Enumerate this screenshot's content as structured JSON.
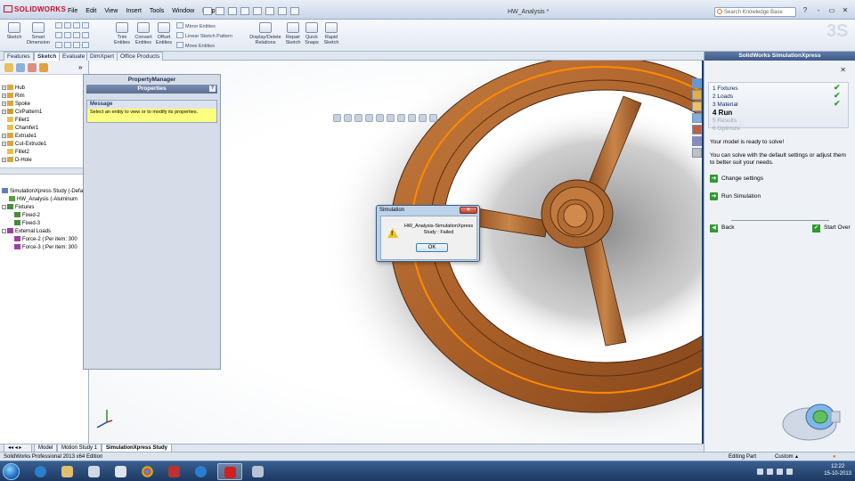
{
  "app": {
    "brand": "SOLIDWORKS",
    "document_title": "HW_Analysis *",
    "menu": [
      "File",
      "Edit",
      "View",
      "Insert",
      "Tools",
      "Window",
      "Help"
    ],
    "search_placeholder": "Search Knowledge Base",
    "window_controls": [
      "?",
      "-",
      "▭",
      "✕"
    ]
  },
  "ribbon": {
    "buttons": [
      {
        "label": "Sketch"
      },
      {
        "label": "Smart\nDimension"
      },
      {
        "label": "Trim\nEntities"
      },
      {
        "label": "Convert\nEntities"
      },
      {
        "label": "Offset\nEntities"
      },
      {
        "label": "Display/Delete\nRelations"
      },
      {
        "label": "Repair\nSketch"
      },
      {
        "label": "Quick\nSnaps"
      },
      {
        "label": "Rapid\nSketch"
      }
    ],
    "small": [
      "Mirror Entities",
      "Linear Sketch Pattern",
      "Move Entities"
    ]
  },
  "tabs": [
    "Features",
    "Sketch",
    "Evaluate",
    "DimXpert",
    "Office Products"
  ],
  "active_tab": "Sketch",
  "feature_tree": [
    "Hub",
    "Rim",
    "Spoke",
    "CirPattern1",
    "Fillet1",
    "Chamfer1",
    "Extrude1",
    "Cut-Extrude1",
    "Fillet2",
    "D-Hole"
  ],
  "study_tree": [
    {
      "label": "SimulationXpress Study (-Defa",
      "indent": 0
    },
    {
      "label": "HW_Analysis (-Aluminum",
      "indent": 1
    },
    {
      "label": "Fixtures",
      "indent": 0
    },
    {
      "label": "Fixed-2",
      "indent": 2
    },
    {
      "label": "Fixed-3",
      "indent": 2
    },
    {
      "label": "External Loads",
      "indent": 0
    },
    {
      "label": "Force-2 (:Per item: 300",
      "indent": 2
    },
    {
      "label": "Force-3 (:Per item: 300",
      "indent": 2
    }
  ],
  "property_manager": {
    "header": "PropertyManager",
    "section": "Properties",
    "help": "?",
    "message_title": "Message",
    "message_text": "Select an entity to view or to modify its properties."
  },
  "simx": {
    "title": "SolidWorks SimulationXpress",
    "close": "✕",
    "steps": [
      {
        "label": "1  Fixtures",
        "state": "done"
      },
      {
        "label": "2  Loads",
        "state": "done"
      },
      {
        "label": "3  Material",
        "state": "done"
      },
      {
        "label": "4  Run",
        "state": "current"
      },
      {
        "label": "5  Results",
        "state": "pending"
      },
      {
        "label": "6  Optimize",
        "state": "pending"
      }
    ],
    "ready_text": "Your model is ready to solve!",
    "hint_text": "You can solve with the default settings or adjust them to better suit your needs.",
    "change_settings": "Change settings",
    "run_simulation": "Run Simulation",
    "back": "Back",
    "start_over": "Start Over"
  },
  "dialog": {
    "title": "Simulation",
    "close": "✕",
    "message": "HW_Analysis-SimulationXpress Study : Failed",
    "ok": "OK"
  },
  "bottom_tabs": [
    "Model",
    "Motion Study 1",
    "SimulationXpress Study"
  ],
  "active_bottom_tab": "SimulationXpress Study",
  "status": {
    "left": "SolidWorks Professional 2013 x64 Edition",
    "mode": "Editing Part",
    "units": "Custom"
  },
  "taskbar": {
    "time": "12:22",
    "date": "15-10-2013"
  },
  "colors": {
    "wheel": "#b5692f",
    "wheel_dark": "#6e3a17",
    "highlight": "#ff8a00",
    "accent": "#3e5a89"
  },
  "icons": {
    "search": "search-icon",
    "warning": "warning-icon",
    "check": "check-icon",
    "arrow": "arrow-right-icon"
  }
}
